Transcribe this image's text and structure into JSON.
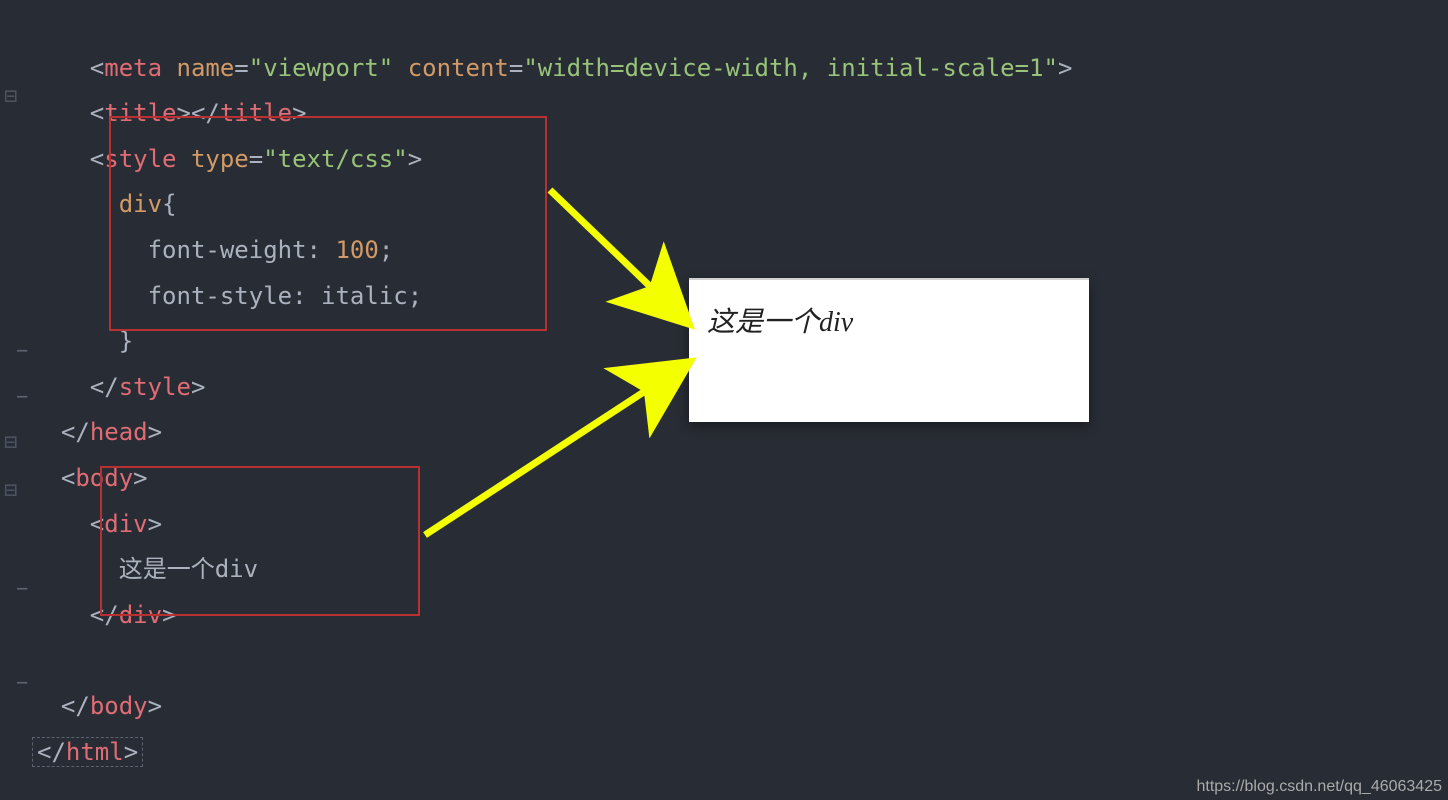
{
  "code": {
    "line1_partial": "<meta name=\"viewport\" content=\"width=device-width, initial-scale=1\">",
    "title_open": "title",
    "title_close": "title",
    "style_tag": "style",
    "style_attr_name": "type",
    "style_attr_value": "\"text/css\"",
    "css_selector": "div",
    "css_brace_open": "{",
    "css_prop1": "font-weight",
    "css_val1": "100",
    "css_prop2": "font-style",
    "css_val2": "italic",
    "css_brace_close": "}",
    "head_close": "head",
    "body_tag": "body",
    "div_tag": "div",
    "div_text": "这是一个div",
    "html_tag": "html"
  },
  "preview": {
    "text": "这是一个div"
  },
  "watermark": "https://blog.csdn.net/qq_46063425"
}
